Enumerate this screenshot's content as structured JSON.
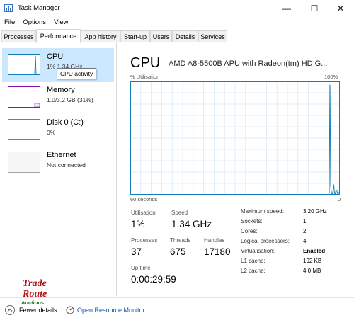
{
  "window": {
    "title": "Task Manager",
    "minimize_glyph": "—",
    "maximize_glyph": "☐",
    "close_glyph": "✕"
  },
  "menu": [
    "File",
    "Options",
    "View"
  ],
  "tabs": [
    {
      "label": "Processes"
    },
    {
      "label": "Performance",
      "active": true
    },
    {
      "label": "App history"
    },
    {
      "label": "Start-up"
    },
    {
      "label": "Users"
    },
    {
      "label": "Details"
    },
    {
      "label": "Services"
    }
  ],
  "sidebar": {
    "items": [
      {
        "title": "CPU",
        "subtitle": "1% 1.34 GHz",
        "color": "#117dbb",
        "selected": true
      },
      {
        "title": "Memory",
        "subtitle": "1.0/3.2 GB (31%)",
        "color": "#8b12ae"
      },
      {
        "title": "Disk 0 (C:)",
        "subtitle": "0%",
        "color": "#4da60c"
      },
      {
        "title": "Ethernet",
        "subtitle": "Not connected",
        "color": "#a7a7a7"
      }
    ],
    "tooltip": "CPU activity"
  },
  "main": {
    "title": "CPU",
    "model": "AMD A8-5500B APU with Radeon(tm) HD G...",
    "graph": {
      "y_label": "% Utilisation",
      "y_max_label": "100%",
      "x_label": "60 seconds",
      "line_color": "#117dbb",
      "grid_color": "#d9eaf7",
      "utilisation_samples": [
        0,
        0,
        0,
        0,
        0,
        0,
        0,
        0,
        0,
        0,
        0,
        0,
        0,
        0,
        0,
        0,
        0,
        0,
        0,
        0,
        0,
        0,
        0,
        0,
        0,
        0,
        0,
        0,
        0,
        0,
        0,
        0,
        0,
        0,
        0,
        0,
        0,
        0,
        0,
        0,
        0,
        0,
        0,
        0,
        0,
        0,
        0,
        0,
        0,
        0,
        0,
        0,
        0,
        0,
        0,
        0,
        0,
        0,
        0,
        0,
        0,
        0,
        0,
        0,
        0,
        0,
        0,
        0,
        0,
        0,
        0,
        0,
        0,
        0,
        0,
        0,
        0,
        0,
        0,
        0,
        0,
        0,
        0,
        0,
        0,
        0,
        0,
        0,
        0,
        0,
        0,
        0,
        0,
        0,
        0,
        0,
        0,
        0,
        0,
        0,
        0,
        0,
        0,
        0,
        0,
        0,
        0,
        0,
        0,
        0,
        0,
        0,
        0,
        0,
        0,
        0,
        0,
        0,
        0,
        0,
        0,
        0,
        0,
        0,
        0,
        0,
        0,
        0,
        0,
        0,
        0,
        0,
        0,
        0,
        0,
        0,
        0,
        0,
        0,
        0,
        0,
        0,
        0,
        0,
        0,
        0,
        0,
        0,
        0,
        0,
        0,
        0,
        0,
        0,
        0,
        0,
        0,
        0,
        0,
        0,
        0,
        0,
        0,
        0,
        0,
        0,
        0,
        0,
        0,
        0,
        0,
        0,
        0,
        0,
        0,
        0,
        0,
        0,
        0,
        0,
        0,
        0,
        0,
        0,
        0,
        0,
        0,
        0,
        0,
        0,
        0,
        0,
        0,
        0,
        0,
        0,
        0,
        0,
        0,
        0,
        0,
        0,
        0,
        0,
        0,
        0,
        0,
        0,
        0,
        0,
        0,
        0,
        0,
        0,
        0,
        0,
        0,
        0,
        0,
        0,
        0,
        0,
        0,
        0,
        0,
        0,
        0,
        0,
        0,
        0,
        0,
        0,
        0,
        0,
        0,
        0,
        0,
        0,
        0,
        0,
        0,
        0,
        0,
        0,
        0,
        0,
        0,
        0,
        0,
        0,
        0,
        0,
        0,
        0,
        0,
        0,
        0,
        0,
        0,
        0,
        0,
        2,
        97,
        8,
        1,
        1,
        3,
        9,
        1,
        1,
        4,
        4,
        1,
        1,
        2,
        1
      ]
    },
    "stats": {
      "utilisation": {
        "label": "Utilisation",
        "value": "1%"
      },
      "speed": {
        "label": "Speed",
        "value": "1.34 GHz"
      },
      "processes": {
        "label": "Processes",
        "value": "37"
      },
      "threads": {
        "label": "Threads",
        "value": "675"
      },
      "handles": {
        "label": "Handles",
        "value": "17180"
      },
      "uptime": {
        "label": "Up time",
        "value": "0:00:29:59"
      }
    },
    "specs": [
      {
        "label": "Maximum speed:",
        "value": "3.20 GHz"
      },
      {
        "label": "Sockets:",
        "value": "1"
      },
      {
        "label": "Cores:",
        "value": "2"
      },
      {
        "label": "Logical processors:",
        "value": "4"
      },
      {
        "label": "Virtualisation:",
        "value": "Enabled"
      },
      {
        "label": "L1 cache:",
        "value": "192 KB"
      },
      {
        "label": "L2 cache:",
        "value": "4.0 MB"
      }
    ]
  },
  "footer": {
    "fewer_details": "Fewer details",
    "open_resource_monitor": "Open Resource Monitor",
    "link_color": "#0b59b3"
  },
  "watermark": {
    "line1": "Trade",
    "line2": "Route",
    "line3": "Auctions"
  }
}
